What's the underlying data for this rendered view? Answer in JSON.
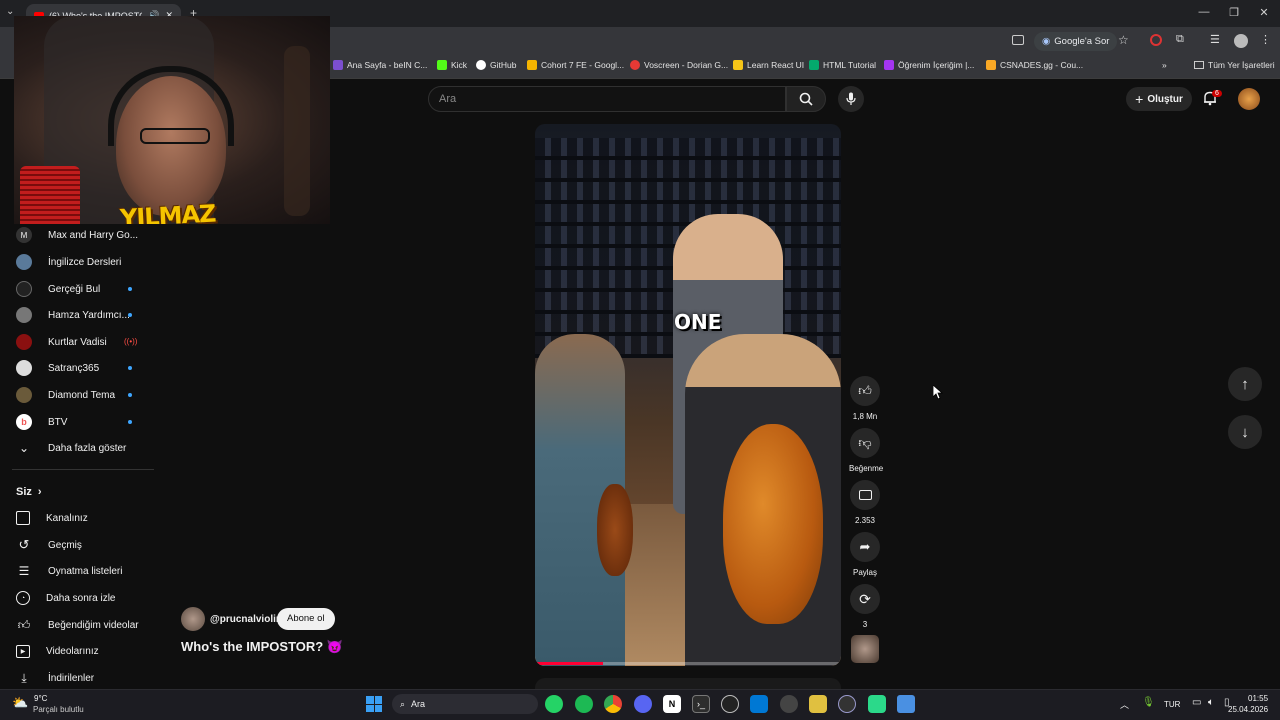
{
  "browser": {
    "tab_title": "(6) Who's the IMPOSTOR?",
    "ask_google": "Google'a Sor",
    "bookmarks": [
      {
        "label": "Ana Sayfa - beIN C...",
        "color": "#7b4fcf"
      },
      {
        "label": "Kick",
        "color": "#53fc18"
      },
      {
        "label": "GitHub",
        "color": "#ffffff"
      },
      {
        "label": "Cohort 7 FE - Googl...",
        "color": "#f4b400"
      },
      {
        "label": "Voscreen - Dorian G...",
        "color": "#e53935"
      },
      {
        "label": "Learn React UI",
        "color": "#f5c518"
      },
      {
        "label": "HTML Tutorial",
        "color": "#04aa6d"
      },
      {
        "label": "Öğrenim İçeriğim |...",
        "color": "#a435f0"
      },
      {
        "label": "CSNADES.gg - Cou...",
        "color": "#f9a825"
      }
    ],
    "all_bookmarks": "Tüm Yer İşaretleri"
  },
  "webcam": {
    "overlay_name": "YILMAZ"
  },
  "youtube": {
    "search_placeholder": "Ara",
    "create_label": "Oluştur",
    "notification_count": "6"
  },
  "sidebar": {
    "subscriptions": [
      {
        "label": "Max and Harry Go...",
        "icon": "channel-avatar",
        "color": "#444",
        "live": false
      },
      {
        "label": "İngilizce Dersleri",
        "icon": "channel-avatar",
        "color": "#5a7a9a",
        "live": false
      },
      {
        "label": "Gerçeği Bul",
        "icon": "channel-avatar",
        "color": "#222",
        "live": true
      },
      {
        "label": "Hamza Yardımcı...",
        "icon": "channel-avatar",
        "color": "#777",
        "live": true
      },
      {
        "label": "Kurtlar Vadisi",
        "icon": "channel-avatar",
        "color": "#8a1010",
        "live": false,
        "streaming": true
      },
      {
        "label": "Satranç365",
        "icon": "channel-avatar",
        "color": "#ddd",
        "live": true
      },
      {
        "label": "Diamond Tema",
        "icon": "channel-avatar",
        "color": "#6a5a3a",
        "live": true
      },
      {
        "label": "BTV",
        "icon": "channel-avatar",
        "color": "#fff",
        "live": true
      }
    ],
    "show_more": "Daha fazla göster",
    "you_section": "Siz",
    "you_items": [
      {
        "label": "Kanalınız",
        "icon": "channel-icon"
      },
      {
        "label": "Geçmiş",
        "icon": "history-icon"
      },
      {
        "label": "Oynatma listeleri",
        "icon": "playlist-icon"
      },
      {
        "label": "Daha sonra izle",
        "icon": "clock-icon"
      },
      {
        "label": "Beğendiğim videolar",
        "icon": "thumb-up-icon"
      },
      {
        "label": "Videolarınız",
        "icon": "video-icon"
      },
      {
        "label": "İndirilenler",
        "icon": "download-icon"
      }
    ]
  },
  "short": {
    "caption": "ONE",
    "channel": "@prucnalviolin",
    "subscribe": "Abone ol",
    "title": "Who's the IMPOSTOR? 😈",
    "likes": "1,8 Mn",
    "dislike": "Beğenme",
    "comments": "2.353",
    "share": "Paylaş",
    "remix": "3"
  },
  "taskbar": {
    "weather_temp": "9°C",
    "weather_text": "Parçalı bulutlu",
    "search": "Ara",
    "lang": "TUR",
    "time": "01:55",
    "date": "25.04.2026"
  }
}
